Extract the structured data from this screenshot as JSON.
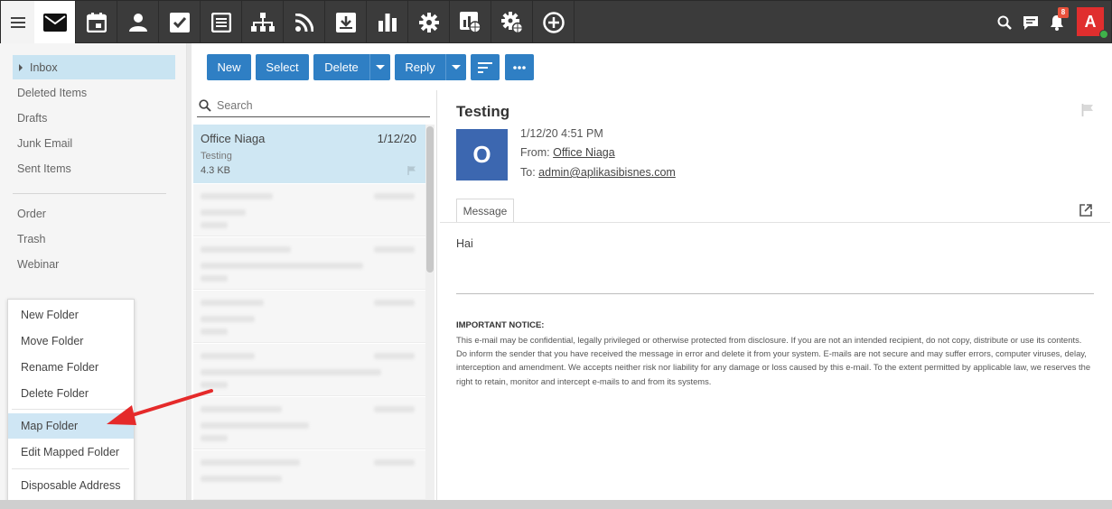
{
  "colors": {
    "topbar": "#3b3b3b",
    "accent": "#2f7fc4",
    "selected": "#cfe7f3",
    "avatar_user": "#e02e2e",
    "avatar_sender": "#3c67b0",
    "annotation_arrow": "#e52a2a"
  },
  "topbar": {
    "icons": [
      "menu-icon",
      "mail-icon",
      "calendar-icon",
      "contacts-icon",
      "tasks-icon",
      "notes-icon",
      "sitemap-icon",
      "rss-icon",
      "download-icon",
      "chart-icon",
      "settings-icon",
      "domain-report-icon",
      "domain-settings-icon",
      "add-icon"
    ],
    "right_icons": [
      "search-icon",
      "chat-icon",
      "bell-icon"
    ],
    "notification_count": "8",
    "user_initial": "A"
  },
  "sidebar": {
    "folders": [
      {
        "label": "Inbox"
      },
      {
        "label": "Deleted Items"
      },
      {
        "label": "Drafts"
      },
      {
        "label": "Junk Email"
      },
      {
        "label": "Sent Items"
      },
      {
        "label": "Order"
      },
      {
        "label": "Trash"
      },
      {
        "label": "Webinar"
      }
    ]
  },
  "context_menu": {
    "items": [
      {
        "label": "New Folder"
      },
      {
        "label": "Move Folder"
      },
      {
        "label": "Rename Folder"
      },
      {
        "label": "Delete Folder"
      },
      {
        "label": "Map Folder"
      },
      {
        "label": "Edit Mapped Folder"
      },
      {
        "label": "Disposable Address"
      }
    ]
  },
  "toolbar": {
    "new": "New",
    "select": "Select",
    "delete": "Delete",
    "reply": "Reply"
  },
  "list": {
    "search_placeholder": "Search",
    "messages": [
      {
        "from": "Office Niaga",
        "date": "1/12/20",
        "subject": "Testing",
        "size": "4.3 KB"
      }
    ]
  },
  "reader": {
    "subject": "Testing",
    "sender_initial": "O",
    "datetime": "1/12/20 4:51 PM",
    "from_label": "From:",
    "from": "Office Niaga",
    "to_label": "To:",
    "to": "admin@aplikasibisnes.com",
    "tab": "Message",
    "body": "Hai",
    "notice_title": "IMPORTANT NOTICE:",
    "notice_text": "This e-mail may be confidential, legally privileged or otherwise protected from disclosure. If you are not an intended recipient, do not copy, distribute or use its contents. Do inform the sender that you have received the message in error and delete it from your system. E-mails are not secure and may suffer errors, computer viruses, delay, interception and amendment. We accepts neither risk nor liability for any damage or loss caused by this e-mail. To the extent permitted by applicable law, we reserves the right to retain, monitor and intercept e-mails to and from its systems."
  }
}
